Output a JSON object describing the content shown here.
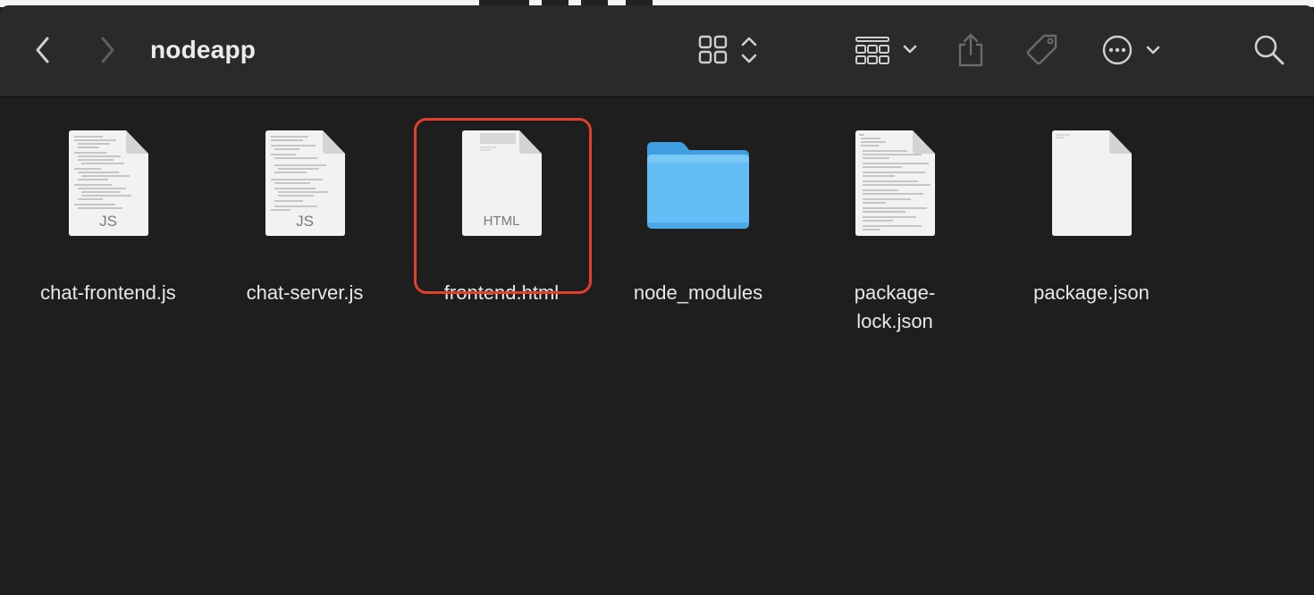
{
  "window": {
    "title": "nodeapp"
  },
  "toolbar": {
    "back_icon": "chevron-left-icon",
    "forward_icon": "chevron-right-icon",
    "view_icon": "icon-grid-view-icon",
    "group_icon": "group-by-icon",
    "share_icon": "share-icon",
    "tag_icon": "tag-icon",
    "more_icon": "ellipsis-circle-icon",
    "search_icon": "magnifying-glass-icon"
  },
  "files": [
    {
      "name": "chat-frontend.js",
      "kind": "js-document",
      "badge": "JS"
    },
    {
      "name": "chat-server.js",
      "kind": "js-document",
      "badge": "JS"
    },
    {
      "name": "frontend.html",
      "kind": "html-document",
      "badge": "HTML",
      "selected": true
    },
    {
      "name": "node_modules",
      "kind": "folder"
    },
    {
      "name": "package-\nlock.json",
      "kind": "json-document"
    },
    {
      "name": "package.json",
      "kind": "json-document"
    }
  ],
  "colors": {
    "toolbar_bg": "#2a2a2a",
    "content_bg": "#1e1e1e",
    "selection_outline": "#e0402d",
    "folder_blue": "#5ab4f0"
  }
}
